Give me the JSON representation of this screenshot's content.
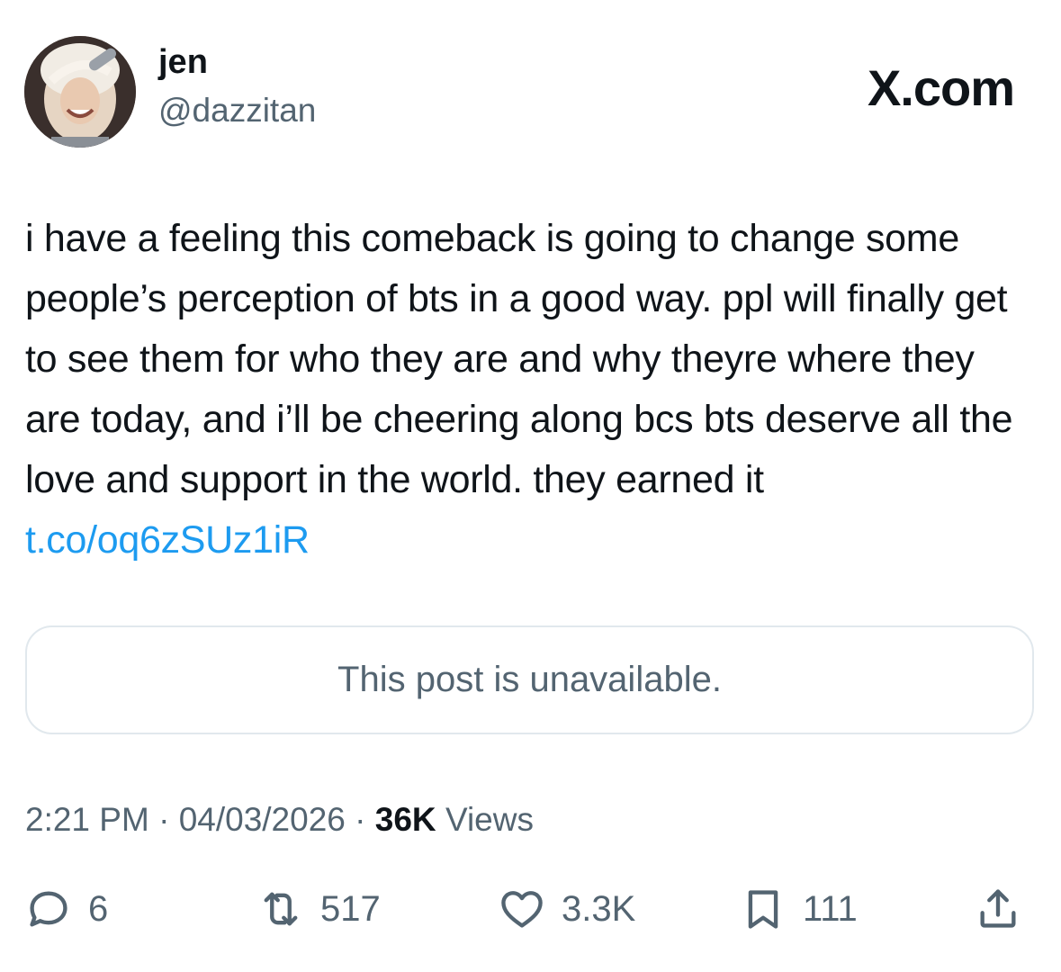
{
  "author": {
    "display_name": "jen",
    "handle": "@dazzitan"
  },
  "brand": "X.com",
  "tweet": {
    "text": "i have a feeling this comeback is going to change some people’s perception of bts in a good way. ppl will finally get to see them for who they are and why theyre where they are today, and i’ll be cheering along bcs bts deserve all the love and support in the world. they earned it ",
    "link": "t.co/oq6zSUz1iR"
  },
  "quoted_post": {
    "message": "This post is unavailable."
  },
  "meta": {
    "time": "2:21 PM",
    "date": "04/03/2026",
    "views_count": "36K",
    "views_label": "Views"
  },
  "actions": {
    "replies": "6",
    "reposts": "517",
    "likes": "3.3K",
    "bookmarks": "111"
  },
  "colors": {
    "link": "#1d9bf0",
    "secondary_text": "#536471",
    "primary_text": "#0f1419",
    "border": "#e1e8ed"
  },
  "icons": [
    "reply-icon",
    "repost-icon",
    "like-icon",
    "bookmark-icon",
    "share-icon"
  ]
}
